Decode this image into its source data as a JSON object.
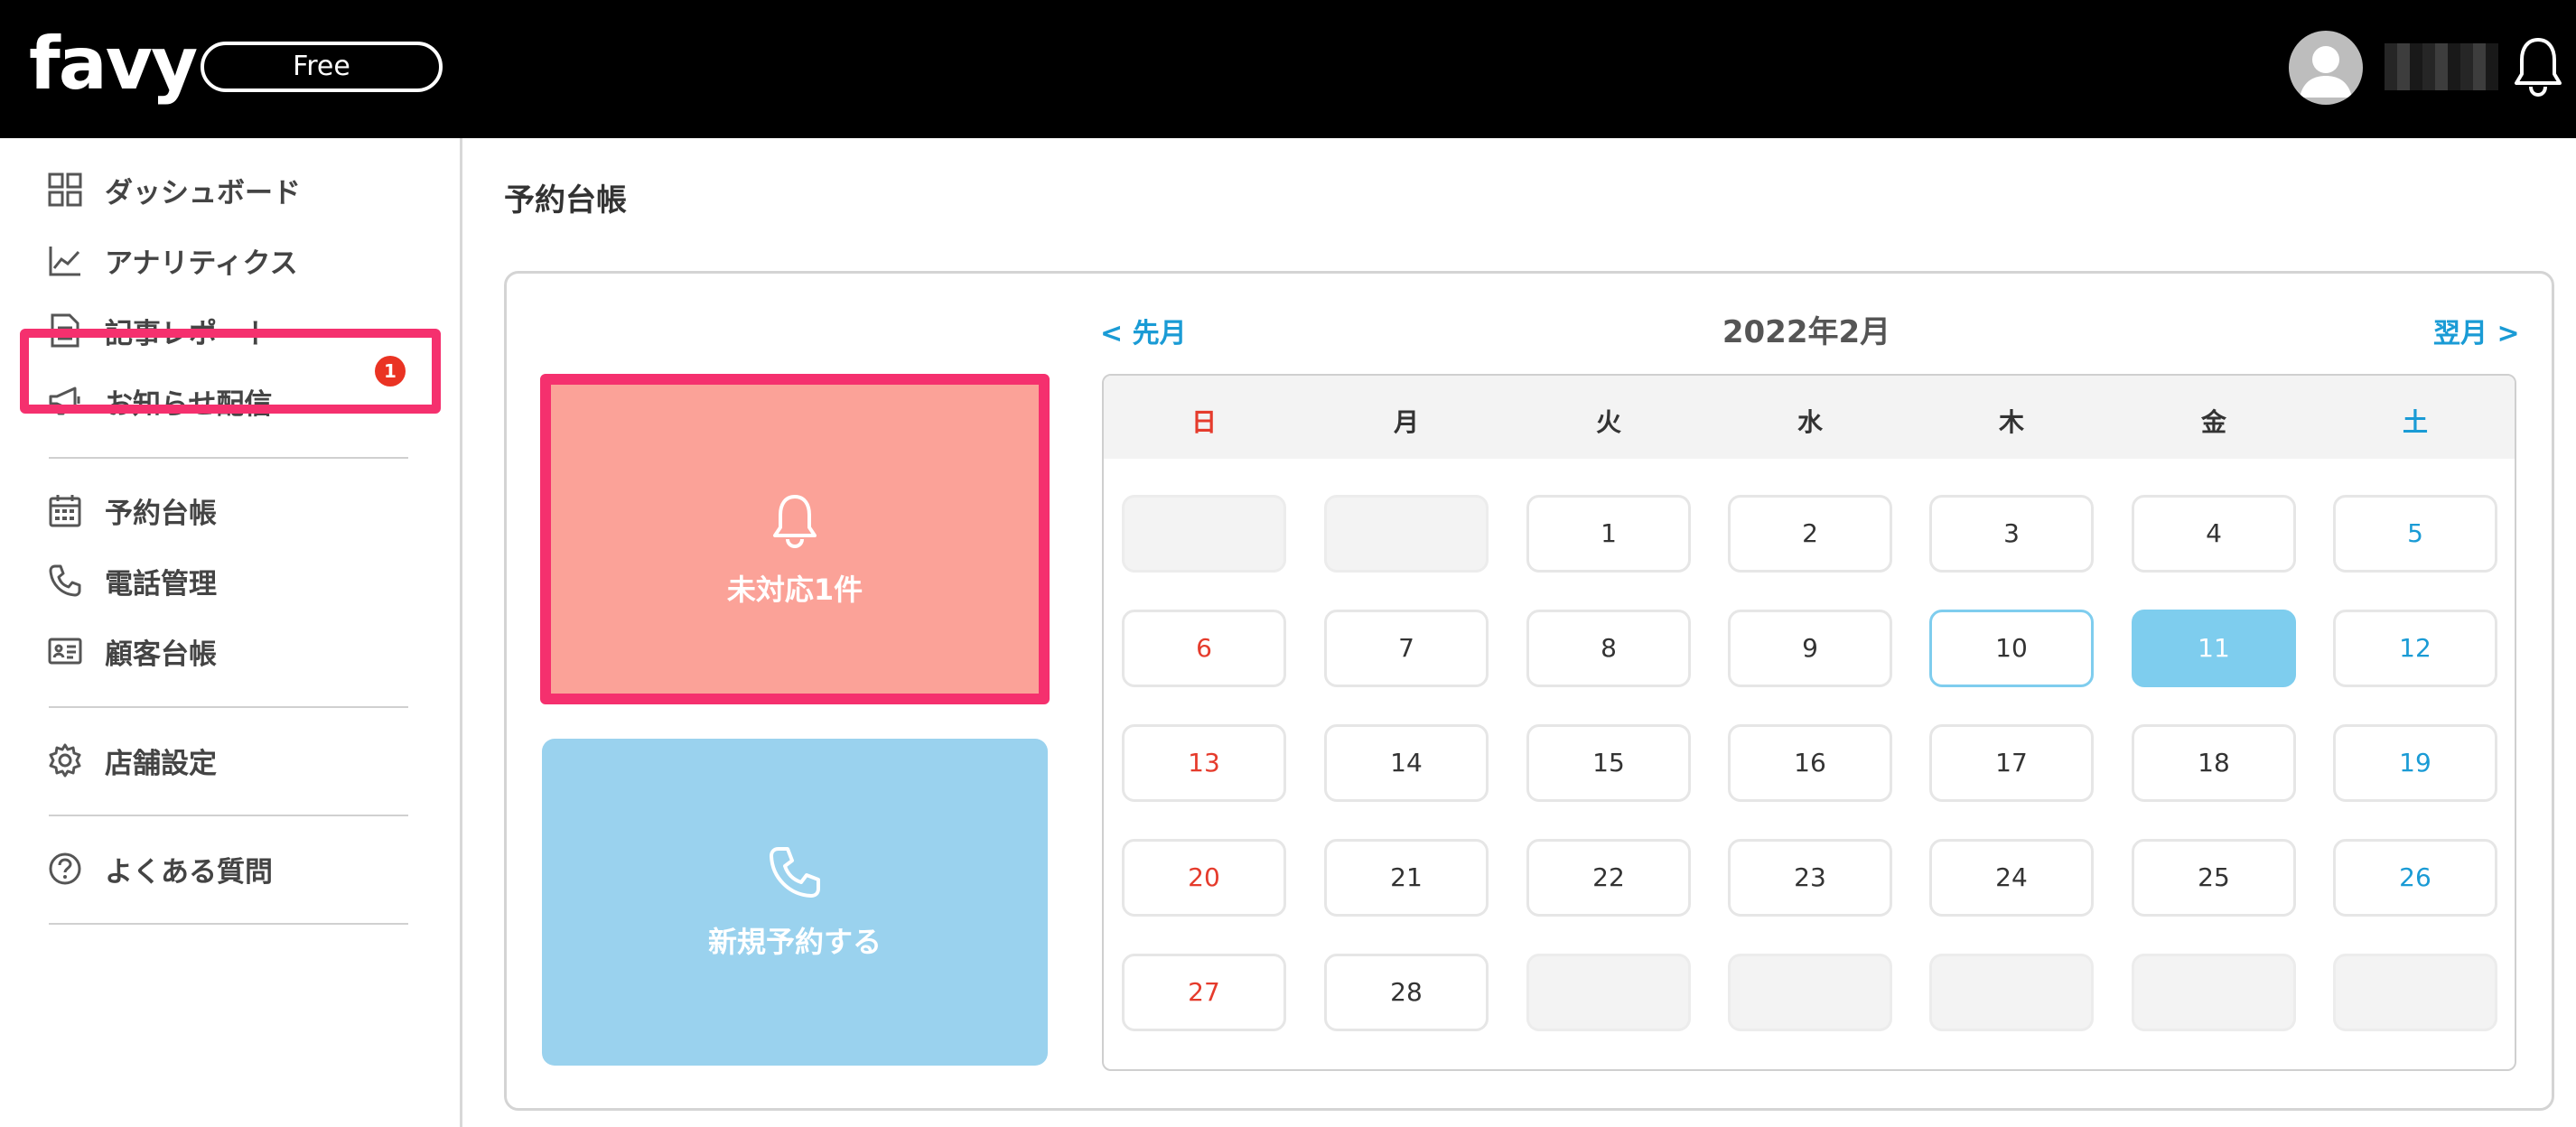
{
  "header": {
    "logo_text": "favy",
    "plan_label": "Free",
    "avatar_icon": "user-avatar-icon",
    "notification_icon": "bell-icon"
  },
  "sidebar": {
    "items": [
      {
        "label": "ダッシュボード",
        "icon": "grid-icon"
      },
      {
        "label": "アナリティクス",
        "icon": "line-chart-icon"
      },
      {
        "label": "記事レポート",
        "icon": "document-icon"
      },
      {
        "label": "お知らせ配信",
        "icon": "megaphone-icon"
      },
      {
        "label": "予約台帳",
        "icon": "calendar-icon",
        "badge": "1",
        "active": true
      },
      {
        "label": "電話管理",
        "icon": "phone-icon"
      },
      {
        "label": "顧客台帳",
        "icon": "id-card-icon"
      },
      {
        "label": "店舗設定",
        "icon": "gear-icon"
      },
      {
        "label": "よくある質問",
        "icon": "question-icon"
      }
    ]
  },
  "main": {
    "page_title": "予約台帳",
    "pending_card": {
      "label": "未対応1件",
      "icon": "bell-icon",
      "color": "#fba298",
      "border_color": "#f5306e"
    },
    "new_card": {
      "label": "新規予約する",
      "icon": "phone-icon",
      "color": "#9ad2ee"
    },
    "calendar": {
      "prev_label": "< 先月",
      "next_label": "翌月 >",
      "title": "2022年2月",
      "weekdays": [
        "日",
        "月",
        "火",
        "水",
        "木",
        "金",
        "土"
      ],
      "weeks": [
        [
          "",
          "",
          "1",
          "2",
          "3",
          "4",
          "5"
        ],
        [
          "6",
          "7",
          "8",
          "9",
          "10",
          "11",
          "12"
        ],
        [
          "13",
          "14",
          "15",
          "16",
          "17",
          "18",
          "19"
        ],
        [
          "20",
          "21",
          "22",
          "23",
          "24",
          "25",
          "26"
        ],
        [
          "27",
          "28",
          "",
          "",
          "",
          "",
          ""
        ]
      ],
      "today": "10",
      "selected": "11",
      "sunday_color": "#e53b2c",
      "saturday_color": "#1a9bd5",
      "selected_color": "#7ecdee"
    }
  }
}
